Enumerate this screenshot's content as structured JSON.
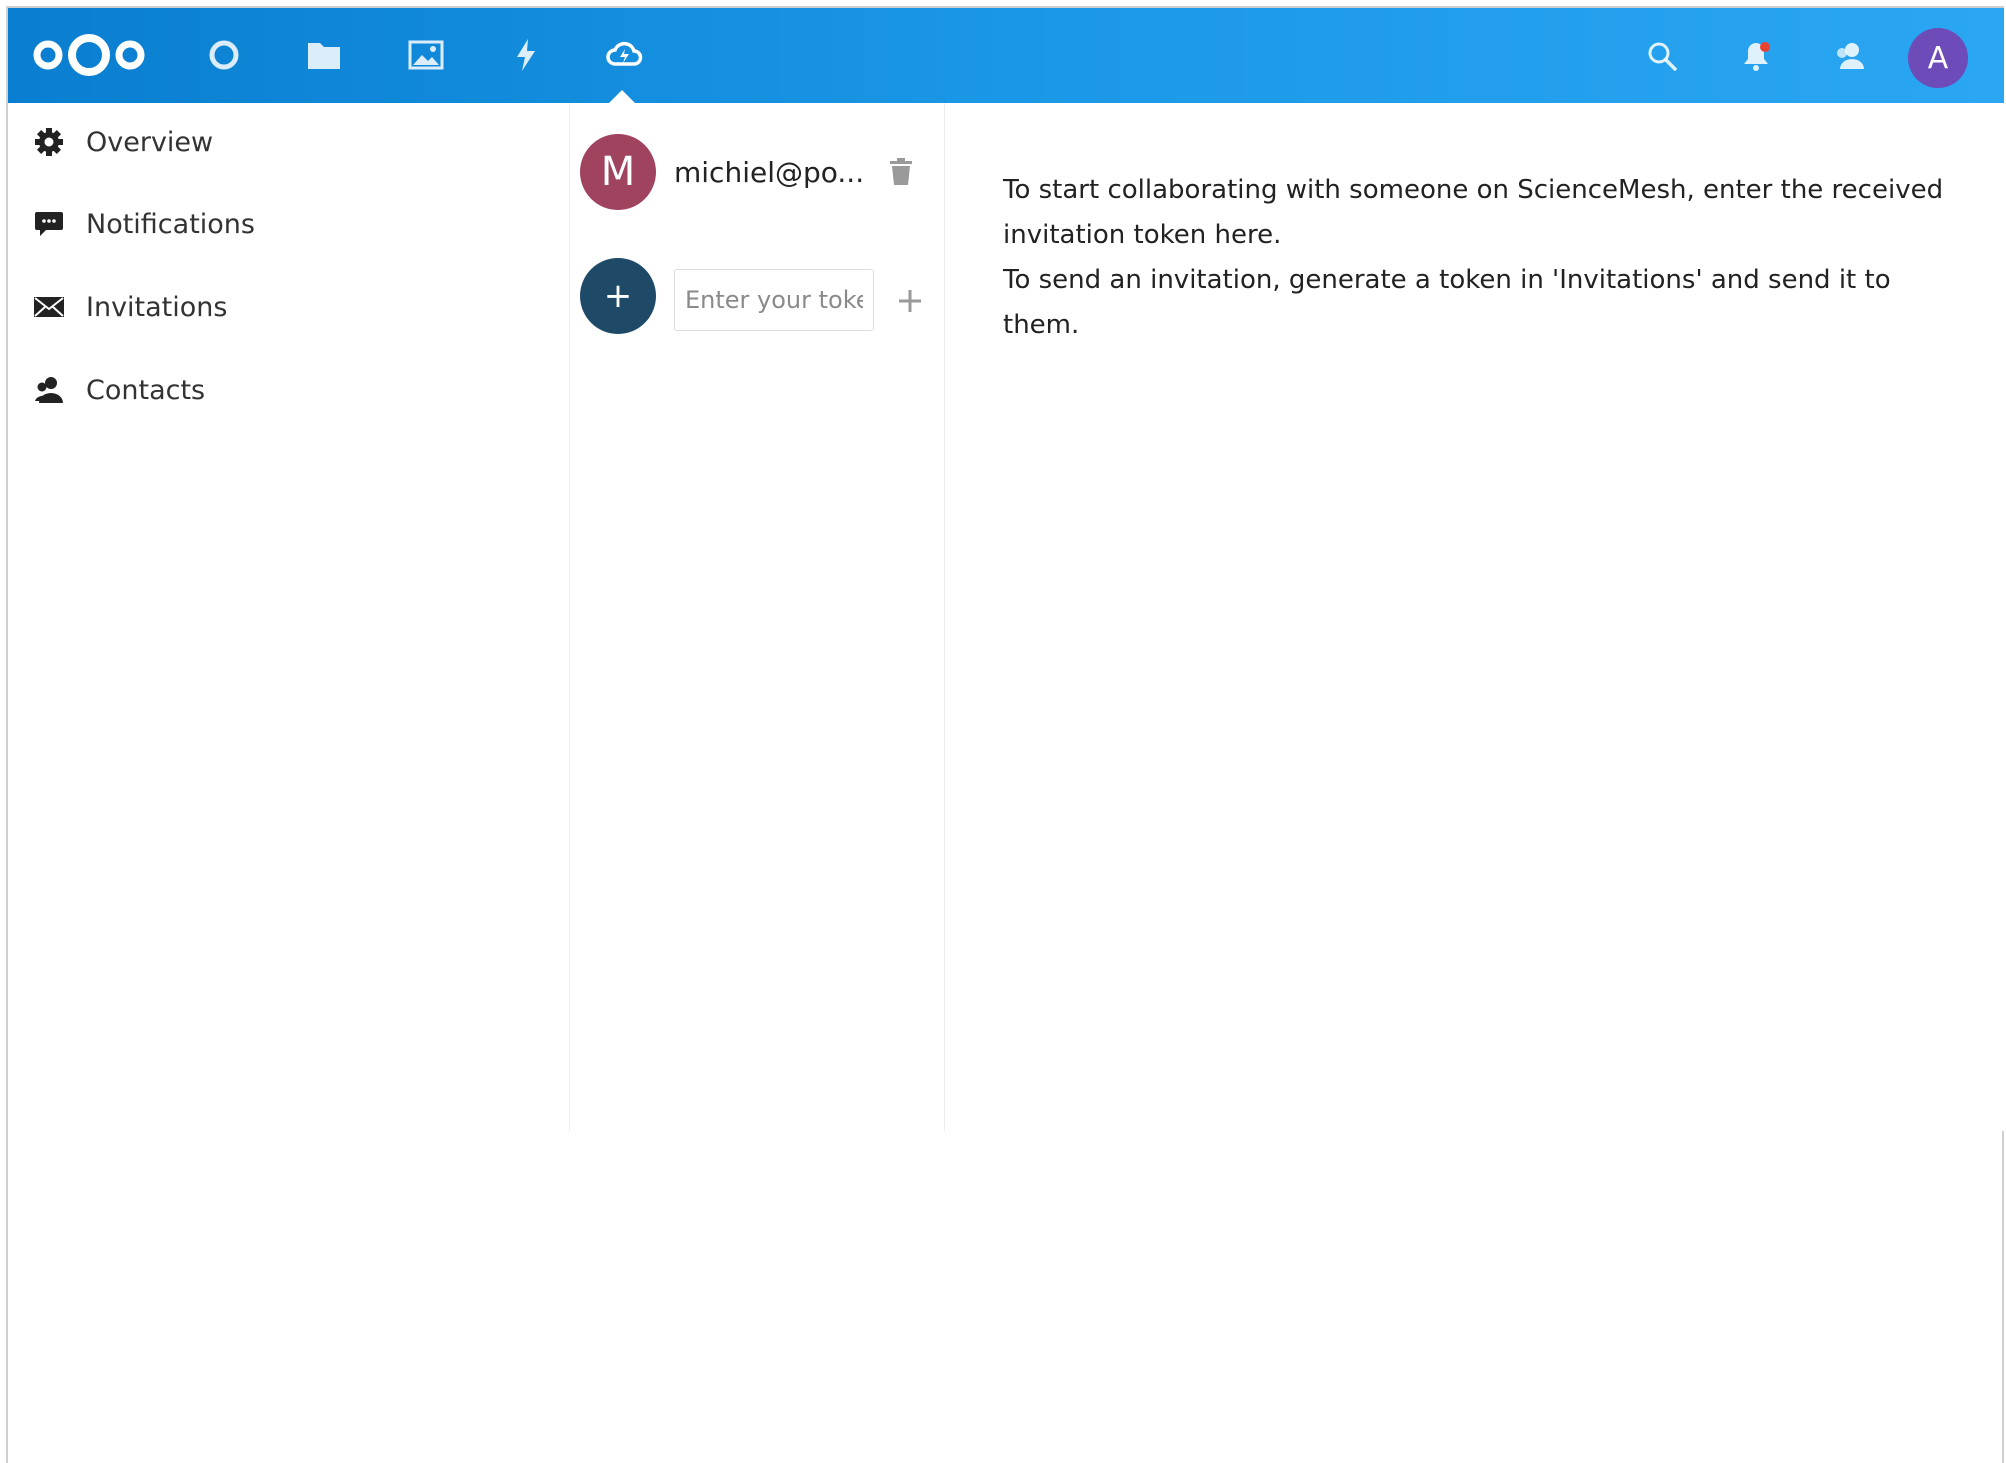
{
  "header": {
    "apps": [
      {
        "name": "dashboard",
        "icon": "circle-icon"
      },
      {
        "name": "files",
        "icon": "folder-icon"
      },
      {
        "name": "photos",
        "icon": "image-icon"
      },
      {
        "name": "activity",
        "icon": "lightning-icon"
      },
      {
        "name": "sciencemesh",
        "icon": "cloud-icon",
        "active": true
      }
    ],
    "right_icons": [
      "search-icon",
      "bell-icon",
      "contacts-icon"
    ],
    "user_avatar_letter": "A",
    "gradient_start": "#0a7ed0",
    "gradient_end": "#2aa6f2"
  },
  "sidebar": {
    "items": [
      {
        "label": "Overview",
        "icon": "gear-icon"
      },
      {
        "label": "Notifications",
        "icon": "chat-bubble-icon"
      },
      {
        "label": "Invitations",
        "icon": "envelope-icon"
      },
      {
        "label": "Contacts",
        "icon": "person-icon"
      }
    ]
  },
  "contacts": {
    "items": [
      {
        "avatar_letter": "M",
        "name": "michiel@po...",
        "avatar_color": "#a0435f"
      }
    ]
  },
  "token": {
    "add_symbol": "+",
    "placeholder": "Enter your token",
    "value": ""
  },
  "content": {
    "line1": "To start collaborating with someone on ScienceMesh, enter the received invitation token here.",
    "line2": "To send an invitation, generate a token in 'Invitations' and send it to them."
  }
}
